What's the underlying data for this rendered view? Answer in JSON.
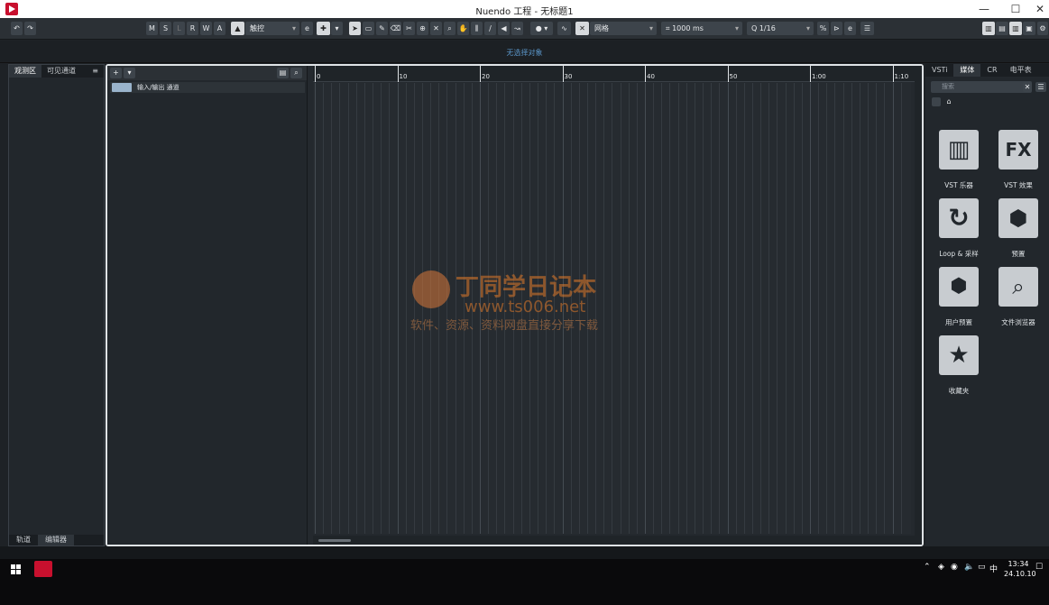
{
  "window": {
    "title": "Nuendo 工程 - 无标题1"
  },
  "toolbar": {
    "undo": "↶",
    "redo": "↷",
    "mode_buttons": [
      "M",
      "S",
      "L",
      "R",
      "W",
      "A"
    ],
    "automation_mode": "触控",
    "snap_type": "网格",
    "snap_value": "1000 ms",
    "quantize": "1/16"
  },
  "infobar": {
    "text": "无选择对象"
  },
  "left_panel": {
    "tabs": [
      "观测区",
      "可见通道"
    ],
    "bottom_tabs": [
      "轨道",
      "编辑器"
    ]
  },
  "tracks": [
    {
      "name": "输入/输出 通道"
    }
  ],
  "ruler": {
    "labels": [
      "0",
      "10",
      "20",
      "30",
      "40",
      "50",
      "1:00",
      "1:10"
    ]
  },
  "right_panel": {
    "tabs": [
      "VSTi",
      "媒体",
      "CR",
      "电平表"
    ],
    "search_placeholder": "搜索",
    "tiles": [
      {
        "label": "VST 乐器",
        "icon": "piano-icon"
      },
      {
        "label": "VST 效果",
        "icon": "fx-icon"
      },
      {
        "label": "Loop & 采样",
        "icon": "loop-icon"
      },
      {
        "label": "预置",
        "icon": "hexagon-icon"
      },
      {
        "label": "用户预置",
        "icon": "user-preset-icon"
      },
      {
        "label": "文件浏览器",
        "icon": "file-browser-icon"
      },
      {
        "label": "收藏夹",
        "icon": "star-icon"
      }
    ]
  },
  "taskbar": {
    "time": "13:34",
    "date": "24.10.10",
    "ime": "中"
  },
  "watermark": {
    "line1": "丁同学日记本",
    "line2": "www.ts006.net",
    "line3": "软件、资源、资料网盘直接分享下载"
  }
}
